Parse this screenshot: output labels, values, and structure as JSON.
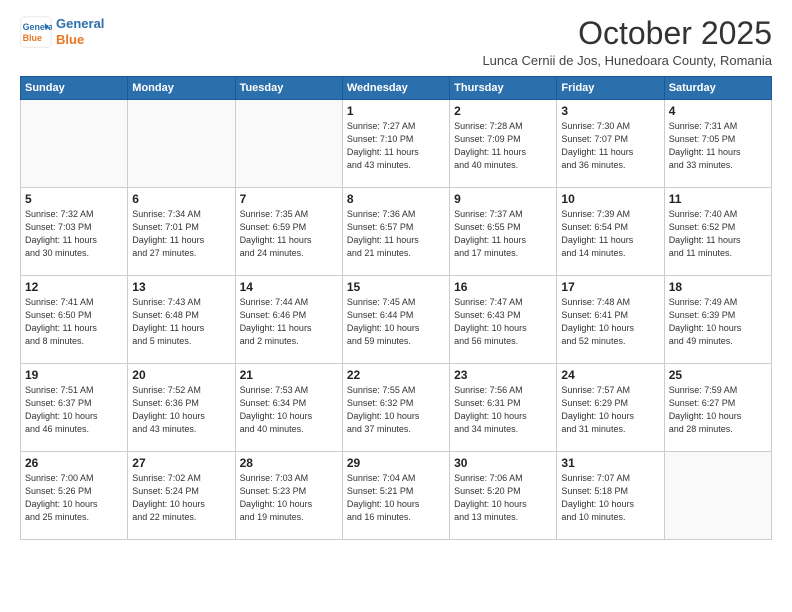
{
  "logo": {
    "line1": "General",
    "line2": "Blue"
  },
  "title": "October 2025",
  "subtitle": "Lunca Cernii de Jos, Hunedoara County, Romania",
  "days_of_week": [
    "Sunday",
    "Monday",
    "Tuesday",
    "Wednesday",
    "Thursday",
    "Friday",
    "Saturday"
  ],
  "weeks": [
    [
      {
        "num": "",
        "info": ""
      },
      {
        "num": "",
        "info": ""
      },
      {
        "num": "",
        "info": ""
      },
      {
        "num": "1",
        "info": "Sunrise: 7:27 AM\nSunset: 7:10 PM\nDaylight: 11 hours\nand 43 minutes."
      },
      {
        "num": "2",
        "info": "Sunrise: 7:28 AM\nSunset: 7:09 PM\nDaylight: 11 hours\nand 40 minutes."
      },
      {
        "num": "3",
        "info": "Sunrise: 7:30 AM\nSunset: 7:07 PM\nDaylight: 11 hours\nand 36 minutes."
      },
      {
        "num": "4",
        "info": "Sunrise: 7:31 AM\nSunset: 7:05 PM\nDaylight: 11 hours\nand 33 minutes."
      }
    ],
    [
      {
        "num": "5",
        "info": "Sunrise: 7:32 AM\nSunset: 7:03 PM\nDaylight: 11 hours\nand 30 minutes."
      },
      {
        "num": "6",
        "info": "Sunrise: 7:34 AM\nSunset: 7:01 PM\nDaylight: 11 hours\nand 27 minutes."
      },
      {
        "num": "7",
        "info": "Sunrise: 7:35 AM\nSunset: 6:59 PM\nDaylight: 11 hours\nand 24 minutes."
      },
      {
        "num": "8",
        "info": "Sunrise: 7:36 AM\nSunset: 6:57 PM\nDaylight: 11 hours\nand 21 minutes."
      },
      {
        "num": "9",
        "info": "Sunrise: 7:37 AM\nSunset: 6:55 PM\nDaylight: 11 hours\nand 17 minutes."
      },
      {
        "num": "10",
        "info": "Sunrise: 7:39 AM\nSunset: 6:54 PM\nDaylight: 11 hours\nand 14 minutes."
      },
      {
        "num": "11",
        "info": "Sunrise: 7:40 AM\nSunset: 6:52 PM\nDaylight: 11 hours\nand 11 minutes."
      }
    ],
    [
      {
        "num": "12",
        "info": "Sunrise: 7:41 AM\nSunset: 6:50 PM\nDaylight: 11 hours\nand 8 minutes."
      },
      {
        "num": "13",
        "info": "Sunrise: 7:43 AM\nSunset: 6:48 PM\nDaylight: 11 hours\nand 5 minutes."
      },
      {
        "num": "14",
        "info": "Sunrise: 7:44 AM\nSunset: 6:46 PM\nDaylight: 11 hours\nand 2 minutes."
      },
      {
        "num": "15",
        "info": "Sunrise: 7:45 AM\nSunset: 6:44 PM\nDaylight: 10 hours\nand 59 minutes."
      },
      {
        "num": "16",
        "info": "Sunrise: 7:47 AM\nSunset: 6:43 PM\nDaylight: 10 hours\nand 56 minutes."
      },
      {
        "num": "17",
        "info": "Sunrise: 7:48 AM\nSunset: 6:41 PM\nDaylight: 10 hours\nand 52 minutes."
      },
      {
        "num": "18",
        "info": "Sunrise: 7:49 AM\nSunset: 6:39 PM\nDaylight: 10 hours\nand 49 minutes."
      }
    ],
    [
      {
        "num": "19",
        "info": "Sunrise: 7:51 AM\nSunset: 6:37 PM\nDaylight: 10 hours\nand 46 minutes."
      },
      {
        "num": "20",
        "info": "Sunrise: 7:52 AM\nSunset: 6:36 PM\nDaylight: 10 hours\nand 43 minutes."
      },
      {
        "num": "21",
        "info": "Sunrise: 7:53 AM\nSunset: 6:34 PM\nDaylight: 10 hours\nand 40 minutes."
      },
      {
        "num": "22",
        "info": "Sunrise: 7:55 AM\nSunset: 6:32 PM\nDaylight: 10 hours\nand 37 minutes."
      },
      {
        "num": "23",
        "info": "Sunrise: 7:56 AM\nSunset: 6:31 PM\nDaylight: 10 hours\nand 34 minutes."
      },
      {
        "num": "24",
        "info": "Sunrise: 7:57 AM\nSunset: 6:29 PM\nDaylight: 10 hours\nand 31 minutes."
      },
      {
        "num": "25",
        "info": "Sunrise: 7:59 AM\nSunset: 6:27 PM\nDaylight: 10 hours\nand 28 minutes."
      }
    ],
    [
      {
        "num": "26",
        "info": "Sunrise: 7:00 AM\nSunset: 5:26 PM\nDaylight: 10 hours\nand 25 minutes."
      },
      {
        "num": "27",
        "info": "Sunrise: 7:02 AM\nSunset: 5:24 PM\nDaylight: 10 hours\nand 22 minutes."
      },
      {
        "num": "28",
        "info": "Sunrise: 7:03 AM\nSunset: 5:23 PM\nDaylight: 10 hours\nand 19 minutes."
      },
      {
        "num": "29",
        "info": "Sunrise: 7:04 AM\nSunset: 5:21 PM\nDaylight: 10 hours\nand 16 minutes."
      },
      {
        "num": "30",
        "info": "Sunrise: 7:06 AM\nSunset: 5:20 PM\nDaylight: 10 hours\nand 13 minutes."
      },
      {
        "num": "31",
        "info": "Sunrise: 7:07 AM\nSunset: 5:18 PM\nDaylight: 10 hours\nand 10 minutes."
      },
      {
        "num": "",
        "info": ""
      }
    ]
  ]
}
